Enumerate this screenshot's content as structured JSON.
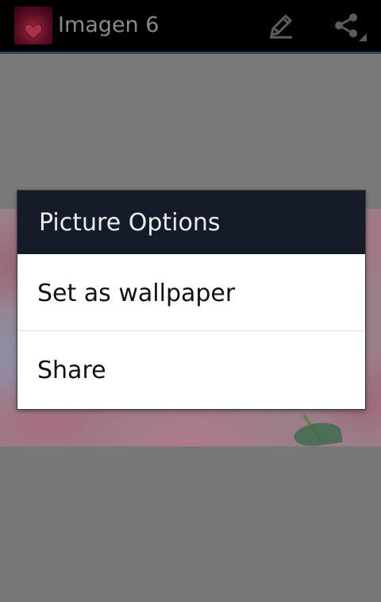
{
  "action_bar": {
    "title": "Imagen 6",
    "app_icon": "app-logo",
    "actions": [
      {
        "id": "edit",
        "icon": "pencil-icon"
      },
      {
        "id": "share",
        "icon": "share-icon"
      }
    ]
  },
  "content": {
    "image": "flower-photo"
  },
  "dialog": {
    "title": "Picture Options",
    "items": [
      {
        "label": "Set as wallpaper"
      },
      {
        "label": "Share"
      }
    ]
  },
  "colors": {
    "action_bar_bg": "#000000",
    "dialog_title_bg": "#141b29",
    "dim_overlay": "#787878"
  }
}
